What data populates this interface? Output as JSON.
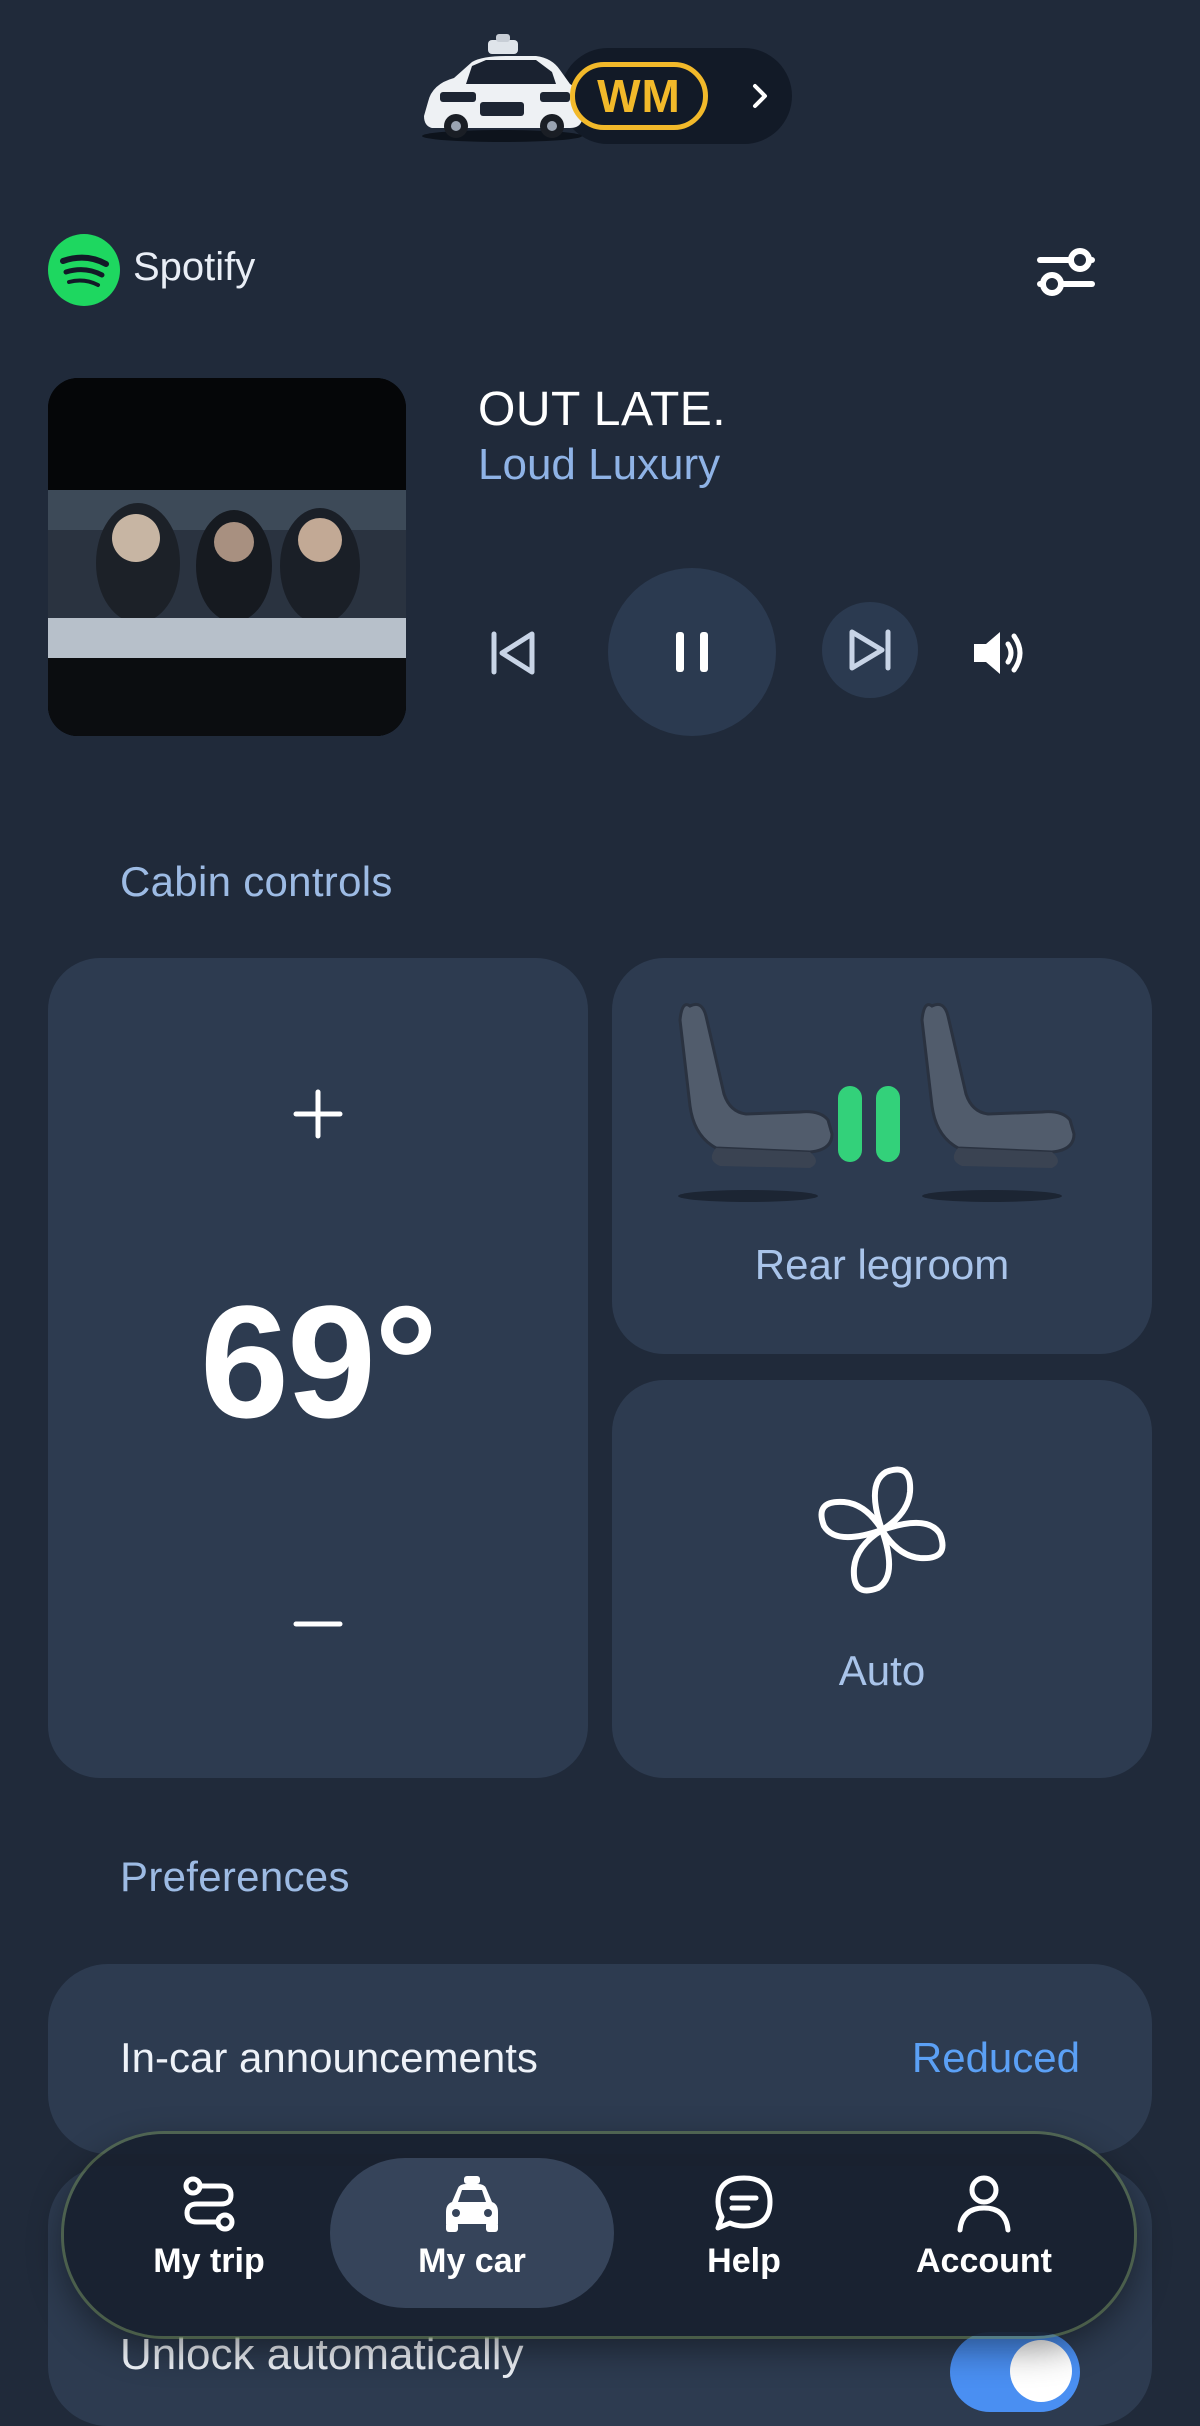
{
  "vehicle": {
    "badge": "WM",
    "chevron_icon": "chevron-right-icon"
  },
  "media": {
    "app_name": "Spotify",
    "app_icon": "spotify-logo-icon",
    "settings_icon": "sliders-icon",
    "track": {
      "title": "OUT LATE.",
      "artist": "Loud Luxury"
    },
    "controls": {
      "previous_icon": "skip-previous-icon",
      "pause_icon": "pause-icon",
      "next_icon": "skip-next-icon",
      "volume_icon": "volume-icon"
    }
  },
  "cabin": {
    "heading": "Cabin controls",
    "temperature": {
      "value": "69°",
      "increase_icon": "plus-icon",
      "decrease_icon": "minus-icon"
    },
    "legroom": {
      "label": "Rear legroom",
      "icon": "seats-pause-icon"
    },
    "fan": {
      "label": "Auto",
      "icon": "fan-icon"
    }
  },
  "preferences": {
    "heading": "Preferences",
    "items": [
      {
        "label": "In-car announcements",
        "value": "Reduced"
      },
      {
        "label": "Unlock automatically",
        "toggle": true
      }
    ]
  },
  "nav": {
    "items": [
      {
        "label": "My trip",
        "icon": "route-icon"
      },
      {
        "label": "My car",
        "icon": "car-icon",
        "active": true
      },
      {
        "label": "Help",
        "icon": "chat-bubble-icon"
      },
      {
        "label": "Account",
        "icon": "person-icon"
      }
    ]
  },
  "colors": {
    "background": "#202a3a",
    "card": "#2d3b50",
    "accent_blue": "#5ba0f5",
    "accent_yellow": "#f2b92a",
    "spotify_green": "#1ed760",
    "legroom_green": "#33d17a"
  }
}
